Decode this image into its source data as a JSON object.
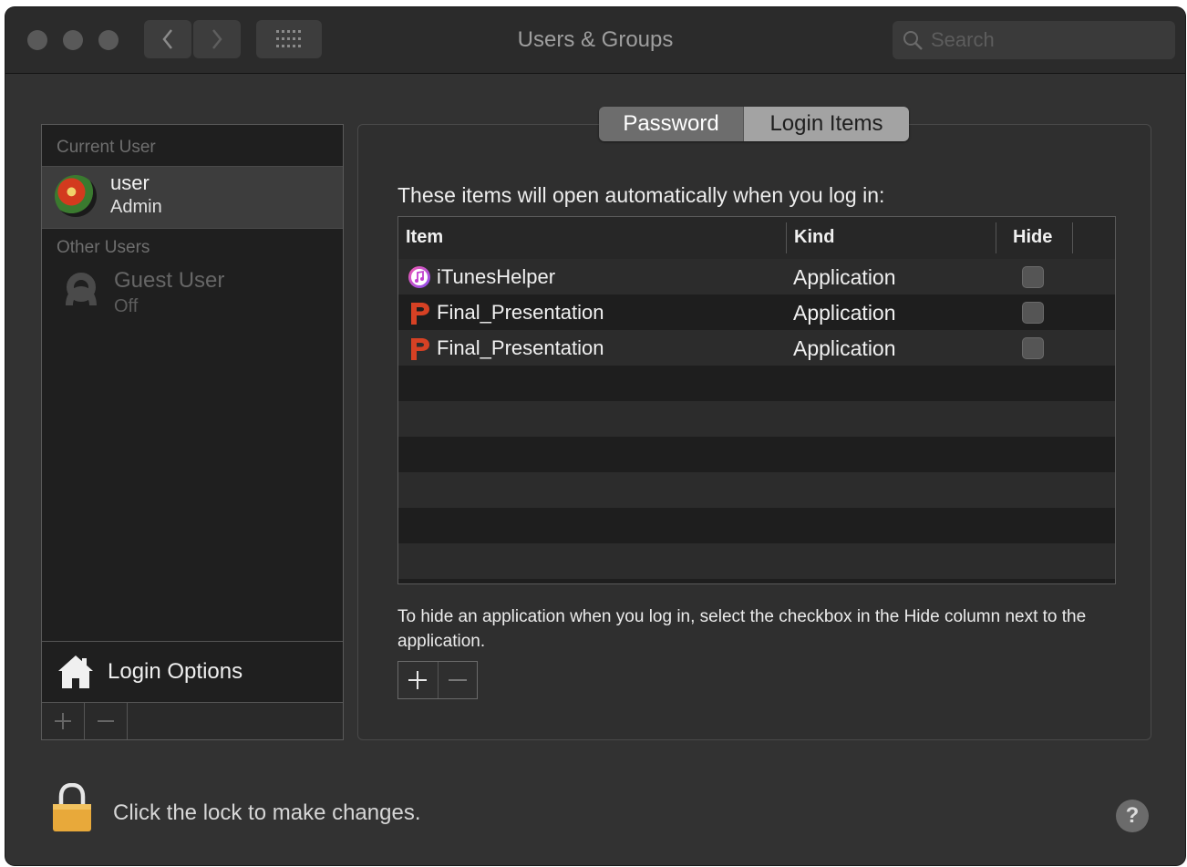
{
  "window": {
    "title": "Users & Groups"
  },
  "search": {
    "placeholder": "Search"
  },
  "sidebar": {
    "current_user_header": "Current User",
    "current_user": {
      "name": "user",
      "role": "Admin"
    },
    "other_users_header": "Other Users",
    "guest_user": {
      "name": "Guest User",
      "state": "Off"
    },
    "login_options_label": "Login Options"
  },
  "tabs": [
    {
      "label": "Password",
      "selected": false
    },
    {
      "label": "Login Items",
      "selected": true
    }
  ],
  "login_items": {
    "intro": "These items will open automatically when you log in:",
    "columns": {
      "item": "Item",
      "kind": "Kind",
      "hide": "Hide"
    },
    "rows": [
      {
        "name": "iTunesHelper",
        "kind": "Application",
        "hide": false,
        "icon": "itunes-helper-icon"
      },
      {
        "name": "Final_Presentation",
        "kind": "Application",
        "hide": false,
        "icon": "powerpoint-icon"
      },
      {
        "name": "Final_Presentation",
        "kind": "Application",
        "hide": false,
        "icon": "powerpoint-icon"
      }
    ],
    "hint": "To hide an application when you log in, select the checkbox in the Hide column next to the application."
  },
  "footer": {
    "lock_text": "Click the lock to make changes.",
    "help_label": "?"
  },
  "colors": {
    "window_bg": "#323232",
    "titlebar_bg": "#2b2b2b",
    "selected_row": "#3d3d3d",
    "lock_gold": "#e8a93a",
    "ppt_red": "#d64124"
  }
}
